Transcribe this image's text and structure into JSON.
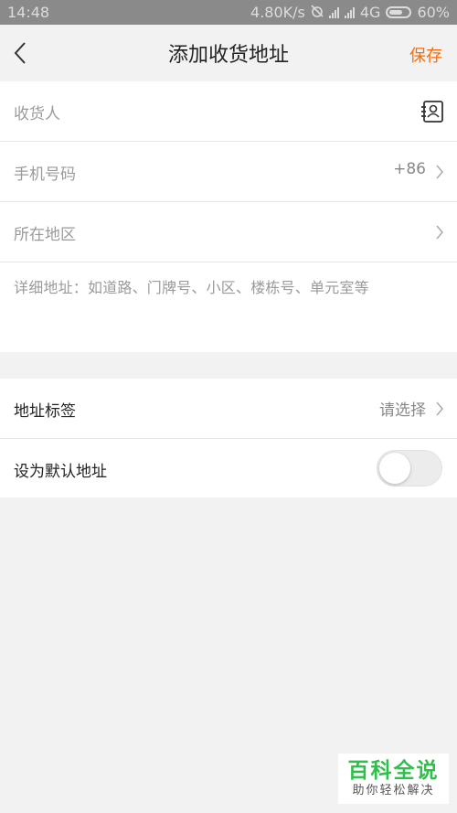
{
  "status_bar": {
    "time": "14:48",
    "speed": "4.80K/s",
    "network": "4G",
    "battery": "60%"
  },
  "header": {
    "title": "添加收货地址",
    "save_label": "保存",
    "accent_color": "#ff6a00"
  },
  "form": {
    "recipient_placeholder": "收货人",
    "phone_placeholder": "手机号码",
    "phone_prefix": "+86",
    "region_placeholder": "所在地区",
    "detail_placeholder": "详细地址：如道路、门牌号、小区、楼栋号、单元室等"
  },
  "options": {
    "tag_label": "地址标签",
    "tag_value": "请选择",
    "default_label": "设为默认地址",
    "default_enabled": false
  },
  "watermark": {
    "main": "百科全说",
    "sub": "助你轻松解决"
  }
}
